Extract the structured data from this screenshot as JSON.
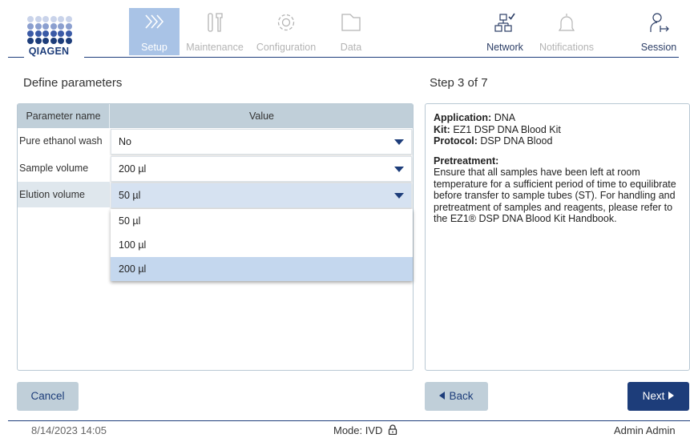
{
  "header": {
    "logo_text": "QIAGEN",
    "colors": {
      "brand": "#1d3d7a",
      "active_tab": "#a9c3e6"
    },
    "tabs": [
      {
        "label": "Setup",
        "icon": "chevrons-right-icon",
        "state": "active"
      },
      {
        "label": "Maintenance",
        "icon": "tools-icon",
        "state": "disabled"
      },
      {
        "label": "Configuration",
        "icon": "gear-icon",
        "state": "disabled"
      },
      {
        "label": "Data",
        "icon": "folder-icon",
        "state": "disabled"
      }
    ],
    "right_tabs": [
      {
        "label": "Network",
        "icon": "network-icon",
        "state": "normal"
      },
      {
        "label": "Notifications",
        "icon": "bell-icon",
        "state": "disabled"
      },
      {
        "label": "Session",
        "icon": "user-logout-icon",
        "state": "normal"
      }
    ]
  },
  "left": {
    "title": "Define parameters",
    "col_name": "Parameter name",
    "col_value": "Value",
    "rows": [
      {
        "name": "Pure ethanol wash",
        "value": "No"
      },
      {
        "name": "Sample volume",
        "value": "200 µl"
      },
      {
        "name": "Elution volume",
        "value": "50 µl"
      }
    ],
    "dropdown_options": [
      "50 µl",
      "100 µl",
      "200 µl"
    ]
  },
  "right": {
    "title": "Step 3 of 7",
    "application_label": "Application:",
    "application_value": "DNA",
    "kit_label": "Kit:",
    "kit_value": "EZ1 DSP DNA Blood Kit",
    "protocol_label": "Protocol:",
    "protocol_value": "DSP DNA Blood",
    "pretreatment_label": "Pretreatment:",
    "pretreatment_text": "Ensure that all samples have been left at room temperature for a sufficient period of time to equilibrate before transfer to sample tubes (ST). For handling and pretreatment of samples and reagents, please refer to the EZ1® DSP DNA Blood Kit Handbook."
  },
  "buttons": {
    "cancel": "Cancel",
    "back": "Back",
    "next": "Next"
  },
  "footer": {
    "datetime": "8/14/2023 14:05",
    "mode": "Mode: IVD",
    "user": "Admin Admin"
  }
}
